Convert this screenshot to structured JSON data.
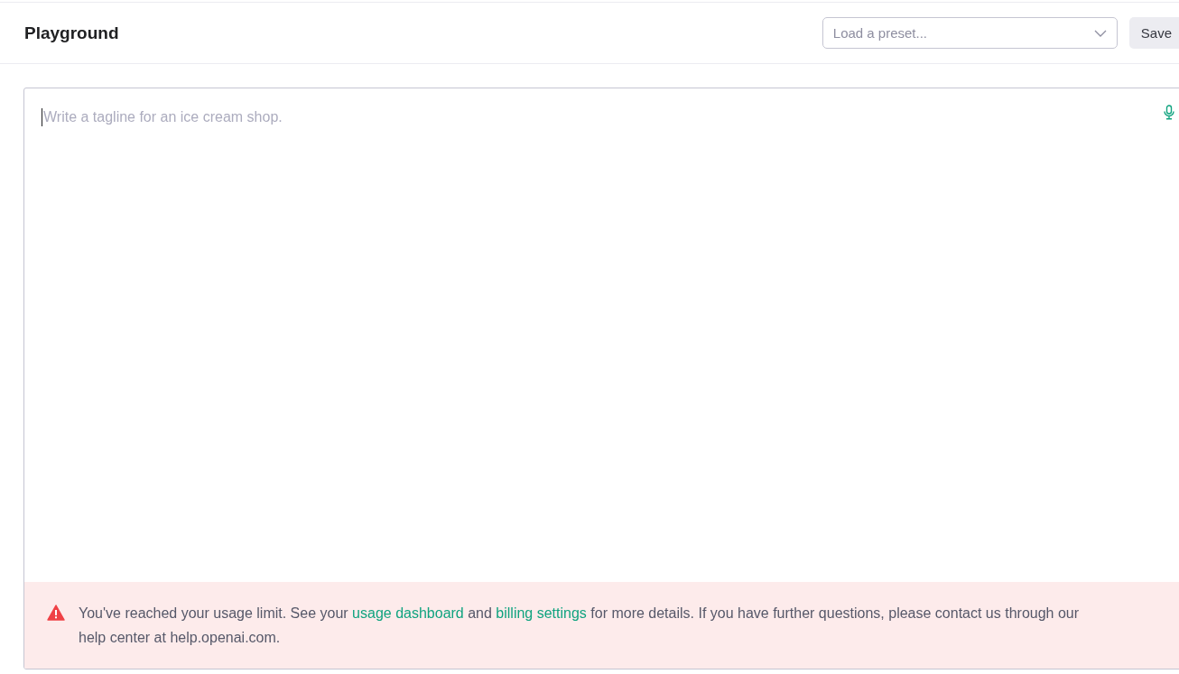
{
  "header": {
    "title": "Playground",
    "preset": {
      "placeholder": "Load a preset..."
    },
    "save_button": "Save"
  },
  "editor": {
    "placeholder": "Write a tagline for an ice cream shop.",
    "focused": true
  },
  "alert": {
    "parts": [
      {
        "kind": "text",
        "text": "You've reached your usage limit. See your "
      },
      {
        "kind": "link",
        "text": "usage dashboard"
      },
      {
        "kind": "text",
        "text": " and "
      },
      {
        "kind": "link",
        "text": "billing settings"
      },
      {
        "kind": "text",
        "text": " for more details. If you have further questions, please contact us through our help center at help.openai.com."
      }
    ]
  }
}
